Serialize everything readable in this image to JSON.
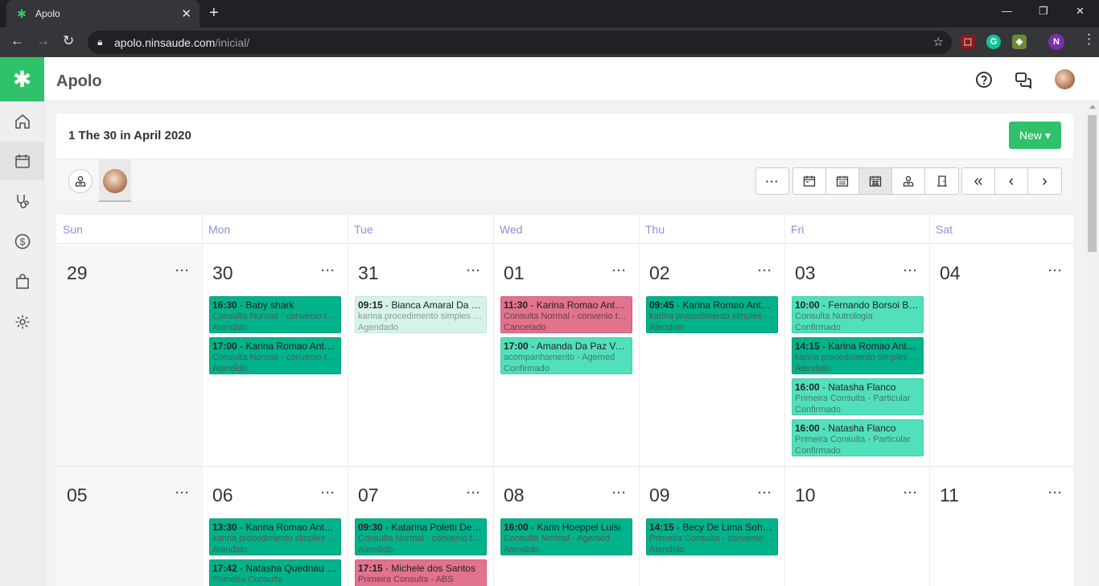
{
  "browser": {
    "tab_title": "Apolo",
    "tab_close": "✕",
    "new_tab": "+",
    "url_domain": "apolo.ninsaude.com",
    "url_path": "/inicial/",
    "profile_initial": "N"
  },
  "app": {
    "title": "Apolo",
    "period_label": "1 The 30 in April 2020",
    "new_button": "New ▾"
  },
  "sidebar": {
    "items": [
      {
        "icon": "home-icon"
      },
      {
        "icon": "calendar-icon",
        "active": true
      },
      {
        "icon": "stethoscope-icon"
      },
      {
        "icon": "dollar-icon"
      },
      {
        "icon": "shopping-bag-icon"
      },
      {
        "icon": "gear-icon"
      }
    ]
  },
  "toolbar": {
    "more": "···",
    "views": [
      "day-view-icon",
      "week-view-icon",
      "month-view-icon",
      "professional-view-icon",
      "room-view-icon"
    ],
    "nav": [
      "«",
      "‹",
      "›"
    ]
  },
  "calendar": {
    "weekdays": [
      "Sun",
      "Mon",
      "Tue",
      "Wed",
      "Thu",
      "Fri",
      "Sat"
    ],
    "more": "···",
    "weeks": [
      {
        "days": [
          {
            "num": "29",
            "events": []
          },
          {
            "num": "30",
            "events": [
              {
                "time": "16:30",
                "name": "Baby shark",
                "line2": "Consulta Normal - convenio teste",
                "line3": "Atendido",
                "status": "att"
              },
              {
                "time": "17:00",
                "name": "Karina Romao Antunes",
                "line2": "Consulta Normal - convenio teste",
                "line3": "Atendido",
                "status": "att"
              }
            ]
          },
          {
            "num": "31",
            "events": [
              {
                "time": "09:15",
                "name": "Bianca Amaral Da Rosa",
                "line2": "karina procedimento simples - Agemed",
                "line3": "Agendado",
                "status": "ag"
              }
            ]
          },
          {
            "num": "01",
            "events": [
              {
                "time": "11:30",
                "name": "Karina Romao Antunes",
                "line2": "Consulta Normal - convenio teste",
                "line3": "Cancelado",
                "status": "can"
              },
              {
                "time": "17:00",
                "name": "Amanda Da Paz Vereda",
                "line2": "acompanhamento - Agemed",
                "line3": "Confirmado",
                "status": "con"
              }
            ]
          },
          {
            "num": "02",
            "events": [
              {
                "time": "09:45",
                "name": "Karina Romao Antunes",
                "line2": "karina procedimento simples - Agemed",
                "line3": "Atendido",
                "status": "att"
              }
            ]
          },
          {
            "num": "03",
            "events": [
              {
                "time": "10:00",
                "name": "Fernando Borsoi Bortoli",
                "line2": "Consulta Nutrologia",
                "line3": "Confirmado",
                "status": "con"
              },
              {
                "time": "14:15",
                "name": "Karina Romao Antunes",
                "line2": "karina procedimento simples - Agemed",
                "line3": "Atendido",
                "status": "att"
              },
              {
                "time": "16:00",
                "name": "Natasha Flanco",
                "line2": "Primeira Consulta - Particular",
                "line3": "Confirmado",
                "status": "con"
              },
              {
                "time": "16:00",
                "name": "Natasha Flanco",
                "line2": "Primeira Consulta - Particular",
                "line3": "Confirmado",
                "status": "con"
              }
            ]
          },
          {
            "num": "04",
            "events": []
          }
        ]
      },
      {
        "days": [
          {
            "num": "05",
            "events": []
          },
          {
            "num": "06",
            "events": [
              {
                "time": "13:30",
                "name": "Karina Romao Antunes",
                "line2": "karina procedimento simples - Agemed",
                "line3": "Atendido",
                "status": "att"
              },
              {
                "time": "17:42",
                "name": "Natasha Quednau Flanco",
                "line2": "Primeira Consulta",
                "line3": "",
                "status": "att"
              }
            ]
          },
          {
            "num": "07",
            "events": [
              {
                "time": "09:30",
                "name": "Katarina Poletti De Souza",
                "line2": "Consulta Normal - convenio teste",
                "line3": "Atendido",
                "status": "att"
              },
              {
                "time": "17:15",
                "name": "Michele dos Santos",
                "line2": "Primeira Consulta - ABS",
                "line3": "",
                "status": "can"
              }
            ]
          },
          {
            "num": "08",
            "events": [
              {
                "time": "16:00",
                "name": "Karin Hoeppel Luisi",
                "line2": "Consulta Normal - Agemed",
                "line3": "Atendido",
                "status": "att"
              }
            ]
          },
          {
            "num": "09",
            "events": [
              {
                "time": "14:15",
                "name": "Becy De Lima Sohnbein",
                "line2": "Primeira Consulta - convenio teste",
                "line3": "Atendido",
                "status": "att"
              }
            ]
          },
          {
            "num": "10",
            "events": []
          },
          {
            "num": "11",
            "events": []
          }
        ]
      }
    ]
  },
  "colors": {
    "brand": "#30c26a",
    "attended": "#00b38a",
    "confirmed": "#52e0bc",
    "cancelled": "#e1738e",
    "scheduled": "#d6f3ea",
    "weekday_text": "#8b8fd8"
  }
}
